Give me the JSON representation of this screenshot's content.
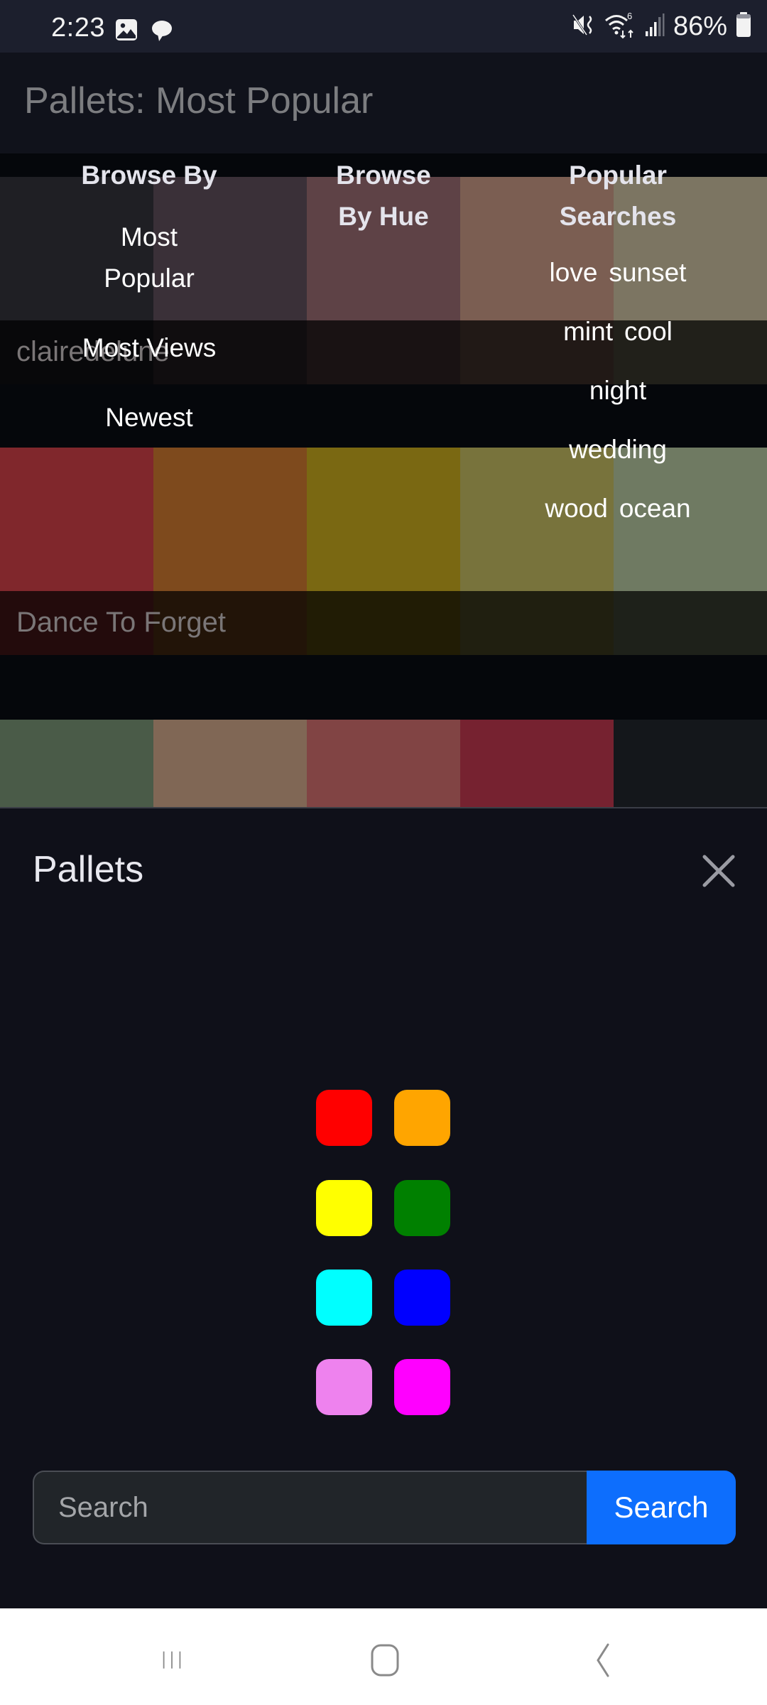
{
  "status_bar": {
    "time": "2:23",
    "left_icons": [
      "gallery-icon",
      "chat-bubble-icon"
    ],
    "right_icons": [
      "mute-vibrate-icon",
      "wifi-6-icon",
      "signal-icon",
      "battery-icon"
    ],
    "battery_percent": "86%"
  },
  "app": {
    "title": "Pallets: Most Popular"
  },
  "palettes": [
    {
      "name": "clairedelune",
      "colors": [
        "#1f1f24",
        "#3a3038",
        "#5e4246",
        "#7b5e52",
        "#7c7562"
      ]
    },
    {
      "name": "Dance To Forget",
      "colors": [
        "#80272c",
        "#7e4a1d",
        "#7a6812",
        "#78733c",
        "#6f7a62"
      ]
    },
    {
      "name": "",
      "colors": [
        "#4a5b48",
        "#806755",
        "#814444",
        "#762230",
        "#14171b"
      ]
    }
  ],
  "offcanvas": {
    "title": "Pallets",
    "close_icon": "close-icon",
    "browse_by": {
      "heading": "Browse By",
      "links": [
        "Most Popular",
        "Most Views",
        "Newest"
      ]
    },
    "browse_by_hue": {
      "heading": "Browse By Hue",
      "hues": [
        {
          "name": "red",
          "color": "#ff0000"
        },
        {
          "name": "orange",
          "color": "#ffa500"
        },
        {
          "name": "yellow",
          "color": "#ffff00"
        },
        {
          "name": "green",
          "color": "#008000"
        },
        {
          "name": "cyan",
          "color": "#00ffff"
        },
        {
          "name": "blue",
          "color": "#0000ff"
        },
        {
          "name": "violet",
          "color": "#ee82ee"
        },
        {
          "name": "magenta",
          "color": "#ff00ff"
        }
      ]
    },
    "popular_searches": {
      "heading": "Popular Searches",
      "rows": [
        [
          "love",
          "sunset"
        ],
        [
          "mint",
          "cool"
        ],
        [
          "night"
        ],
        [
          "wedding"
        ],
        [
          "wood",
          "ocean"
        ]
      ]
    },
    "search": {
      "placeholder": "Search",
      "value": "",
      "button_label": "Search",
      "button_color": "#0d6efd"
    }
  },
  "nav_bar": {
    "buttons": [
      "recent-apps-icon",
      "home-icon",
      "back-icon"
    ]
  }
}
